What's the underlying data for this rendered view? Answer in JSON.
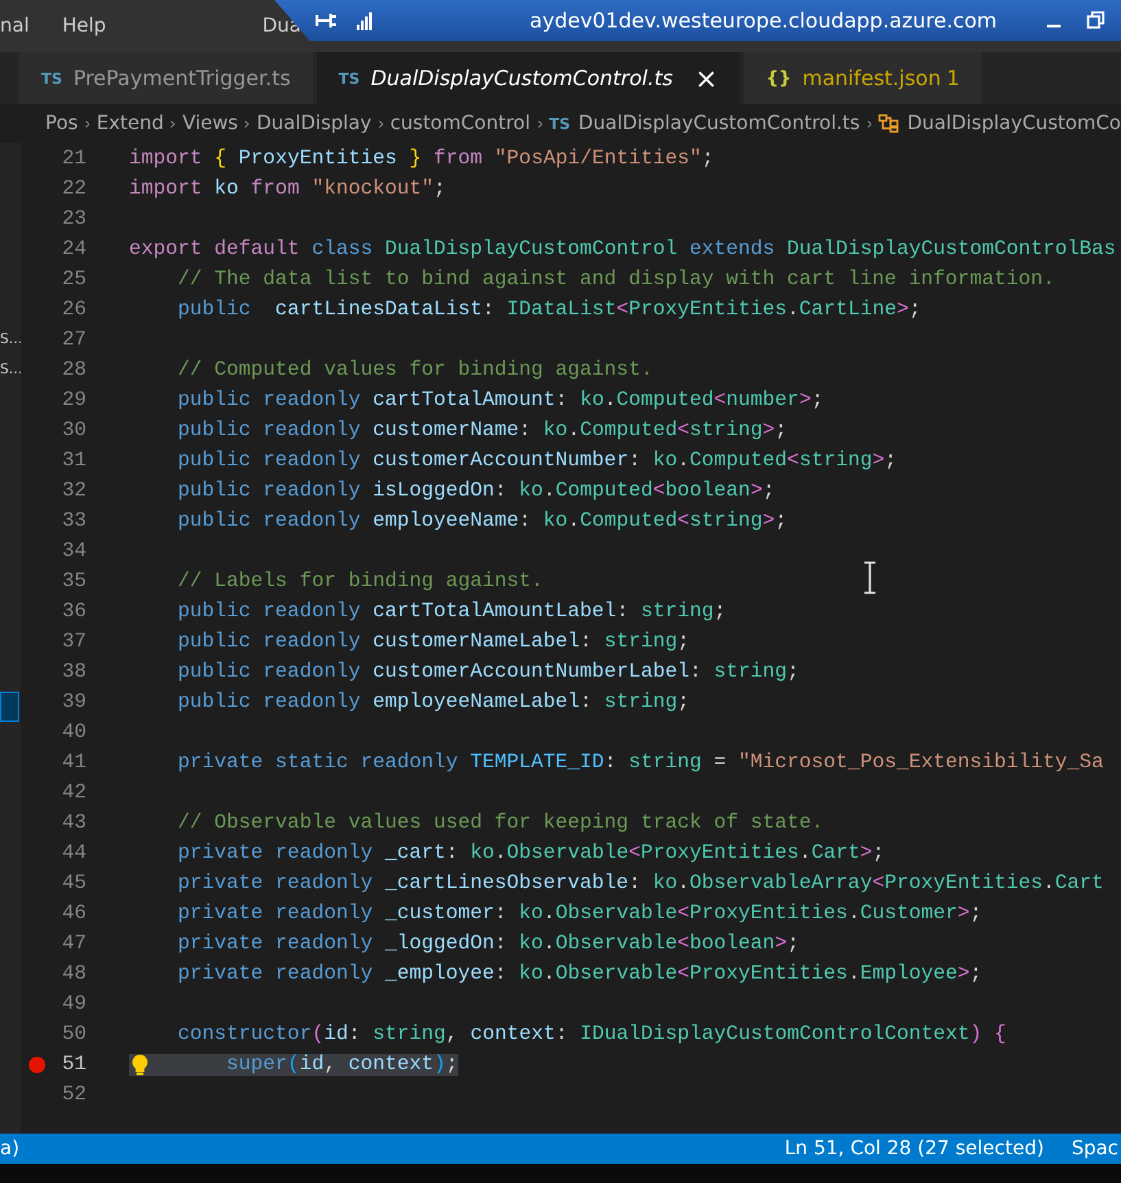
{
  "menu": [
    "nal",
    "Help"
  ],
  "window": {
    "title": "Dua"
  },
  "remote_bar": {
    "host": "aydev01dev.westeurope.cloudapp.azure.com"
  },
  "tabs": [
    {
      "icon_text": "TS",
      "label": "PrePaymentTrigger.ts",
      "selected": false,
      "problems": false
    },
    {
      "icon_text": "TS",
      "label": "DualDisplayCustomControl.ts",
      "selected": true,
      "problems": false,
      "close": "×"
    },
    {
      "icon_text": "{}",
      "label": "manifest.json",
      "selected": false,
      "problems": true,
      "badge": "1"
    }
  ],
  "breadcrumbs": [
    {
      "kind": "folder",
      "label": "Pos"
    },
    {
      "kind": "folder",
      "label": "Extend"
    },
    {
      "kind": "folder",
      "label": "Views"
    },
    {
      "kind": "folder",
      "label": "DualDisplay"
    },
    {
      "kind": "folder",
      "label": "customControl"
    },
    {
      "kind": "file",
      "icon_text": "TS",
      "label": "DualDisplayCustomControl.ts"
    },
    {
      "kind": "class",
      "label": "DualDisplayCustomCo"
    }
  ],
  "sidebar": {
    "items": [
      {
        "label": "S…",
        "selected": false
      },
      {
        "label": "S…",
        "selected": false
      }
    ]
  },
  "editor": {
    "lines": [
      {
        "n": "21",
        "selected": false,
        "breakpoint": false,
        "lightbulb": false,
        "tokens": [
          {
            "kind": "kw",
            "text": "import"
          },
          {
            "kind": "br1",
            "text": " {"
          },
          {
            "kind": "var",
            "text": " ProxyEntities"
          },
          {
            "kind": "br1",
            "text": " }"
          },
          {
            "kind": "kw",
            "text": " from"
          },
          {
            "kind": "str",
            "text": " \"PosApi/Entities\""
          },
          {
            "kind": "pl",
            "text": ";"
          }
        ]
      },
      {
        "n": "22",
        "selected": false,
        "breakpoint": false,
        "lightbulb": false,
        "tokens": [
          {
            "kind": "kw",
            "text": "import"
          },
          {
            "kind": "var",
            "text": " ko"
          },
          {
            "kind": "kw",
            "text": " from"
          },
          {
            "kind": "str",
            "text": " \"knockout\""
          },
          {
            "kind": "pl",
            "text": ";"
          }
        ]
      },
      {
        "n": "23",
        "selected": false,
        "breakpoint": false,
        "lightbulb": false
      },
      {
        "n": "24",
        "selected": false,
        "breakpoint": false,
        "lightbulb": false,
        "tokens": [
          {
            "kind": "kw",
            "text": "export default"
          },
          {
            "kind": "sto",
            "text": " class"
          },
          {
            "kind": "type",
            "text": " DualDisplayCustomControl"
          },
          {
            "kind": "sto",
            "text": " extends"
          },
          {
            "kind": "type",
            "text": " DualDisplayCustomControlBas"
          }
        ]
      },
      {
        "n": "25",
        "selected": false,
        "breakpoint": false,
        "lightbulb": false,
        "tokens": [
          {
            "kind": "cmt",
            "text": "    // The data list to bind against and display with cart line information."
          }
        ]
      },
      {
        "n": "26",
        "selected": false,
        "breakpoint": false,
        "lightbulb": false,
        "tokens": [
          {
            "kind": "sto",
            "text": "    public"
          },
          {
            "kind": "var",
            "text": "  cartLinesDataList"
          },
          {
            "kind": "pl",
            "text": ":"
          },
          {
            "kind": "type",
            "text": " IDataList"
          },
          {
            "kind": "br2",
            "text": "<"
          },
          {
            "kind": "type",
            "text": "ProxyEntities"
          },
          {
            "kind": "pl",
            "text": "."
          },
          {
            "kind": "type",
            "text": "CartLine"
          },
          {
            "kind": "br2",
            "text": ">"
          },
          {
            "kind": "pl",
            "text": ";"
          }
        ]
      },
      {
        "n": "27",
        "selected": false,
        "breakpoint": false,
        "lightbulb": false
      },
      {
        "n": "28",
        "selected": false,
        "breakpoint": false,
        "lightbulb": false,
        "tokens": [
          {
            "kind": "cmt",
            "text": "    // Computed values for binding against."
          }
        ]
      },
      {
        "n": "29",
        "selected": false,
        "breakpoint": false,
        "lightbulb": false,
        "tokens": [
          {
            "kind": "sto",
            "text": "    public readonly"
          },
          {
            "kind": "var",
            "text": " cartTotalAmount"
          },
          {
            "kind": "pl",
            "text": ":"
          },
          {
            "kind": "type",
            "text": " ko"
          },
          {
            "kind": "pl",
            "text": "."
          },
          {
            "kind": "type",
            "text": "Computed"
          },
          {
            "kind": "br2",
            "text": "<"
          },
          {
            "kind": "type",
            "text": "number"
          },
          {
            "kind": "br2",
            "text": ">"
          },
          {
            "kind": "pl",
            "text": ";"
          }
        ]
      },
      {
        "n": "30",
        "selected": false,
        "breakpoint": false,
        "lightbulb": false,
        "tokens": [
          {
            "kind": "sto",
            "text": "    public readonly"
          },
          {
            "kind": "var",
            "text": " customerName"
          },
          {
            "kind": "pl",
            "text": ":"
          },
          {
            "kind": "type",
            "text": " ko"
          },
          {
            "kind": "pl",
            "text": "."
          },
          {
            "kind": "type",
            "text": "Computed"
          },
          {
            "kind": "br2",
            "text": "<"
          },
          {
            "kind": "type",
            "text": "string"
          },
          {
            "kind": "br2",
            "text": ">"
          },
          {
            "kind": "pl",
            "text": ";"
          }
        ]
      },
      {
        "n": "31",
        "selected": false,
        "breakpoint": false,
        "lightbulb": false,
        "tokens": [
          {
            "kind": "sto",
            "text": "    public readonly"
          },
          {
            "kind": "var",
            "text": " customerAccountNumber"
          },
          {
            "kind": "pl",
            "text": ":"
          },
          {
            "kind": "type",
            "text": " ko"
          },
          {
            "kind": "pl",
            "text": "."
          },
          {
            "kind": "type",
            "text": "Computed"
          },
          {
            "kind": "br2",
            "text": "<"
          },
          {
            "kind": "type",
            "text": "string"
          },
          {
            "kind": "br2",
            "text": ">"
          },
          {
            "kind": "pl",
            "text": ";"
          }
        ]
      },
      {
        "n": "32",
        "selected": false,
        "breakpoint": false,
        "lightbulb": false,
        "tokens": [
          {
            "kind": "sto",
            "text": "    public readonly"
          },
          {
            "kind": "var",
            "text": " isLoggedOn"
          },
          {
            "kind": "pl",
            "text": ":"
          },
          {
            "kind": "type",
            "text": " ko"
          },
          {
            "kind": "pl",
            "text": "."
          },
          {
            "kind": "type",
            "text": "Computed"
          },
          {
            "kind": "br2",
            "text": "<"
          },
          {
            "kind": "type",
            "text": "boolean"
          },
          {
            "kind": "br2",
            "text": ">"
          },
          {
            "kind": "pl",
            "text": ";"
          }
        ]
      },
      {
        "n": "33",
        "selected": false,
        "breakpoint": false,
        "lightbulb": false,
        "tokens": [
          {
            "kind": "sto",
            "text": "    public readonly"
          },
          {
            "kind": "var",
            "text": " employeeName"
          },
          {
            "kind": "pl",
            "text": ":"
          },
          {
            "kind": "type",
            "text": " ko"
          },
          {
            "kind": "pl",
            "text": "."
          },
          {
            "kind": "type",
            "text": "Computed"
          },
          {
            "kind": "br2",
            "text": "<"
          },
          {
            "kind": "type",
            "text": "string"
          },
          {
            "kind": "br2",
            "text": ">"
          },
          {
            "kind": "pl",
            "text": ";"
          }
        ]
      },
      {
        "n": "34",
        "selected": false,
        "breakpoint": false,
        "lightbulb": false
      },
      {
        "n": "35",
        "selected": false,
        "breakpoint": false,
        "lightbulb": false,
        "tokens": [
          {
            "kind": "cmt",
            "text": "    // Labels for binding against."
          }
        ]
      },
      {
        "n": "36",
        "selected": false,
        "breakpoint": false,
        "lightbulb": false,
        "tokens": [
          {
            "kind": "sto",
            "text": "    public readonly"
          },
          {
            "kind": "var",
            "text": " cartTotalAmountLabel"
          },
          {
            "kind": "pl",
            "text": ":"
          },
          {
            "kind": "type",
            "text": " string"
          },
          {
            "kind": "pl",
            "text": ";"
          }
        ]
      },
      {
        "n": "37",
        "selected": false,
        "breakpoint": false,
        "lightbulb": false,
        "tokens": [
          {
            "kind": "sto",
            "text": "    public readonly"
          },
          {
            "kind": "var",
            "text": " customerNameLabel"
          },
          {
            "kind": "pl",
            "text": ":"
          },
          {
            "kind": "type",
            "text": " string"
          },
          {
            "kind": "pl",
            "text": ";"
          }
        ]
      },
      {
        "n": "38",
        "selected": false,
        "breakpoint": false,
        "lightbulb": false,
        "tokens": [
          {
            "kind": "sto",
            "text": "    public readonly"
          },
          {
            "kind": "var",
            "text": " customerAccountNumberLabel"
          },
          {
            "kind": "pl",
            "text": ":"
          },
          {
            "kind": "type",
            "text": " string"
          },
          {
            "kind": "pl",
            "text": ";"
          }
        ]
      },
      {
        "n": "39",
        "selected": false,
        "breakpoint": false,
        "lightbulb": false,
        "tokens": [
          {
            "kind": "sto",
            "text": "    public readonly"
          },
          {
            "kind": "var",
            "text": " employeeNameLabel"
          },
          {
            "kind": "pl",
            "text": ":"
          },
          {
            "kind": "type",
            "text": " string"
          },
          {
            "kind": "pl",
            "text": ";"
          }
        ]
      },
      {
        "n": "40",
        "selected": false,
        "breakpoint": false,
        "lightbulb": false
      },
      {
        "n": "41",
        "selected": false,
        "breakpoint": false,
        "lightbulb": false,
        "tokens": [
          {
            "kind": "sto",
            "text": "    private static readonly"
          },
          {
            "kind": "const",
            "text": " TEMPLATE_ID"
          },
          {
            "kind": "pl",
            "text": ":"
          },
          {
            "kind": "type",
            "text": " string"
          },
          {
            "kind": "pl",
            "text": " ="
          },
          {
            "kind": "str",
            "text": " \"Microsot_Pos_Extensibility_Sa"
          }
        ]
      },
      {
        "n": "42",
        "selected": false,
        "breakpoint": false,
        "lightbulb": false
      },
      {
        "n": "43",
        "selected": false,
        "breakpoint": false,
        "lightbulb": false,
        "tokens": [
          {
            "kind": "cmt",
            "text": "    // Observable values used for keeping track of state."
          }
        ]
      },
      {
        "n": "44",
        "selected": false,
        "breakpoint": false,
        "lightbulb": false,
        "tokens": [
          {
            "kind": "sto",
            "text": "    private readonly"
          },
          {
            "kind": "var",
            "text": " _cart"
          },
          {
            "kind": "pl",
            "text": ":"
          },
          {
            "kind": "type",
            "text": " ko"
          },
          {
            "kind": "pl",
            "text": "."
          },
          {
            "kind": "type",
            "text": "Observable"
          },
          {
            "kind": "br2",
            "text": "<"
          },
          {
            "kind": "type",
            "text": "ProxyEntities"
          },
          {
            "kind": "pl",
            "text": "."
          },
          {
            "kind": "type",
            "text": "Cart"
          },
          {
            "kind": "br2",
            "text": ">"
          },
          {
            "kind": "pl",
            "text": ";"
          }
        ]
      },
      {
        "n": "45",
        "selected": false,
        "breakpoint": false,
        "lightbulb": false,
        "tokens": [
          {
            "kind": "sto",
            "text": "    private readonly"
          },
          {
            "kind": "var",
            "text": " _cartLinesObservable"
          },
          {
            "kind": "pl",
            "text": ":"
          },
          {
            "kind": "type",
            "text": " ko"
          },
          {
            "kind": "pl",
            "text": "."
          },
          {
            "kind": "type",
            "text": "ObservableArray"
          },
          {
            "kind": "br2",
            "text": "<"
          },
          {
            "kind": "type",
            "text": "ProxyEntities"
          },
          {
            "kind": "pl",
            "text": "."
          },
          {
            "kind": "type",
            "text": "Cart"
          }
        ]
      },
      {
        "n": "46",
        "selected": false,
        "breakpoint": false,
        "lightbulb": false,
        "tokens": [
          {
            "kind": "sto",
            "text": "    private readonly"
          },
          {
            "kind": "var",
            "text": " _customer"
          },
          {
            "kind": "pl",
            "text": ":"
          },
          {
            "kind": "type",
            "text": " ko"
          },
          {
            "kind": "pl",
            "text": "."
          },
          {
            "kind": "type",
            "text": "Observable"
          },
          {
            "kind": "br2",
            "text": "<"
          },
          {
            "kind": "type",
            "text": "ProxyEntities"
          },
          {
            "kind": "pl",
            "text": "."
          },
          {
            "kind": "type",
            "text": "Customer"
          },
          {
            "kind": "br2",
            "text": ">"
          },
          {
            "kind": "pl",
            "text": ";"
          }
        ]
      },
      {
        "n": "47",
        "selected": false,
        "breakpoint": false,
        "lightbulb": false,
        "tokens": [
          {
            "kind": "sto",
            "text": "    private readonly"
          },
          {
            "kind": "var",
            "text": " _loggedOn"
          },
          {
            "kind": "pl",
            "text": ":"
          },
          {
            "kind": "type",
            "text": " ko"
          },
          {
            "kind": "pl",
            "text": "."
          },
          {
            "kind": "type",
            "text": "Observable"
          },
          {
            "kind": "br2",
            "text": "<"
          },
          {
            "kind": "type",
            "text": "boolean"
          },
          {
            "kind": "br2",
            "text": ">"
          },
          {
            "kind": "pl",
            "text": ";"
          }
        ]
      },
      {
        "n": "48",
        "selected": false,
        "breakpoint": false,
        "lightbulb": false,
        "tokens": [
          {
            "kind": "sto",
            "text": "    private readonly"
          },
          {
            "kind": "var",
            "text": " _employee"
          },
          {
            "kind": "pl",
            "text": ":"
          },
          {
            "kind": "type",
            "text": " ko"
          },
          {
            "kind": "pl",
            "text": "."
          },
          {
            "kind": "type",
            "text": "Observable"
          },
          {
            "kind": "br2",
            "text": "<"
          },
          {
            "kind": "type",
            "text": "ProxyEntities"
          },
          {
            "kind": "pl",
            "text": "."
          },
          {
            "kind": "type",
            "text": "Employee"
          },
          {
            "kind": "br2",
            "text": ">"
          },
          {
            "kind": "pl",
            "text": ";"
          }
        ]
      },
      {
        "n": "49",
        "selected": false,
        "breakpoint": false,
        "lightbulb": false
      },
      {
        "n": "50",
        "selected": false,
        "breakpoint": false,
        "lightbulb": false,
        "tokens": [
          {
            "kind": "sto",
            "text": "    constructor"
          },
          {
            "kind": "br2",
            "text": "("
          },
          {
            "kind": "var",
            "text": "id"
          },
          {
            "kind": "pl",
            "text": ":"
          },
          {
            "kind": "type",
            "text": " string"
          },
          {
            "kind": "pl",
            "text": ","
          },
          {
            "kind": "var",
            "text": " context"
          },
          {
            "kind": "pl",
            "text": ":"
          },
          {
            "kind": "type",
            "text": " IDualDisplayCustomControlContext"
          },
          {
            "kind": "br2",
            "text": ")"
          },
          {
            "kind": "br2",
            "text": " {"
          }
        ]
      },
      {
        "n": "51",
        "selected": true,
        "breakpoint": true,
        "lightbulb": true,
        "tokens": [
          {
            "kind": "sto",
            "text": "        super"
          },
          {
            "kind": "br3",
            "text": "("
          },
          {
            "kind": "var",
            "text": "id"
          },
          {
            "kind": "pl",
            "text": ","
          },
          {
            "kind": "var",
            "text": " context"
          },
          {
            "kind": "br3",
            "text": ")"
          },
          {
            "kind": "pl",
            "text": ";"
          }
        ]
      },
      {
        "n": "52",
        "selected": false,
        "breakpoint": false,
        "lightbulb": false
      }
    ]
  },
  "status_bar": {
    "left": "a)",
    "items": [
      "Ln 51, Col 28 (27 selected)",
      "Spac"
    ]
  }
}
